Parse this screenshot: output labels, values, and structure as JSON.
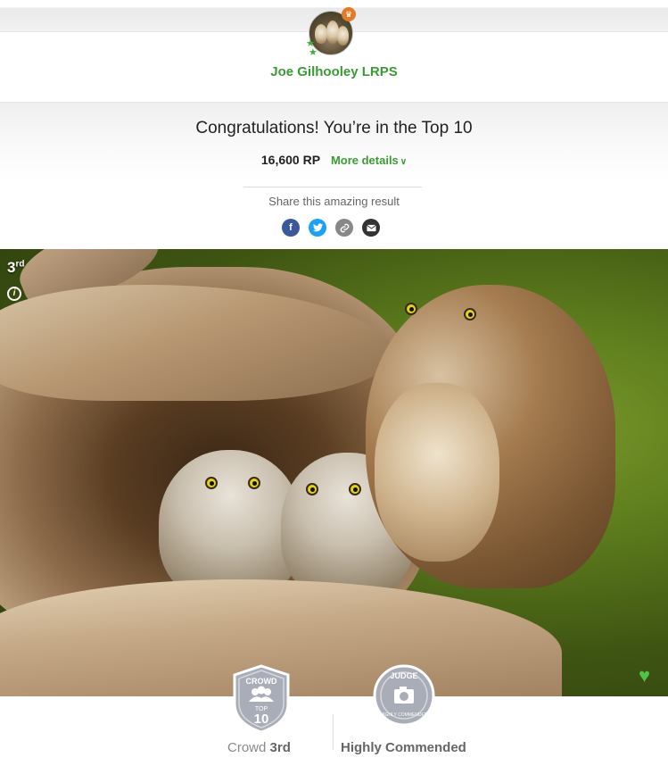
{
  "user": {
    "name": "Joe Gilhooley LRPS",
    "avatar_icon": "owls-avatar",
    "crown_icon": "crown-icon"
  },
  "result": {
    "headline": "Congratulations! You’re in the Top 10",
    "score": "16,600 RP",
    "more_details": "More details"
  },
  "share": {
    "label": "Share this amazing result",
    "icons": [
      "facebook-icon",
      "twitter-icon",
      "link-icon",
      "email-icon"
    ]
  },
  "photo": {
    "rank": "3",
    "rank_suffix": "rd"
  },
  "badges": {
    "crowd": {
      "title": "CROWD",
      "sub": "TOP",
      "value": "10"
    },
    "judge": {
      "title": "JUDGE",
      "sub": "HIGHLY COMMENDED"
    }
  },
  "footer": {
    "crowd_label": "Crowd",
    "crowd_rank": "3rd",
    "judge_label": "Highly Commended"
  },
  "colors": {
    "accent_green": "#3a9b35",
    "facebook": "#3b5998",
    "twitter": "#1da1f2",
    "heart": "#4fc24a",
    "badge_silver": "#a9adb8"
  }
}
